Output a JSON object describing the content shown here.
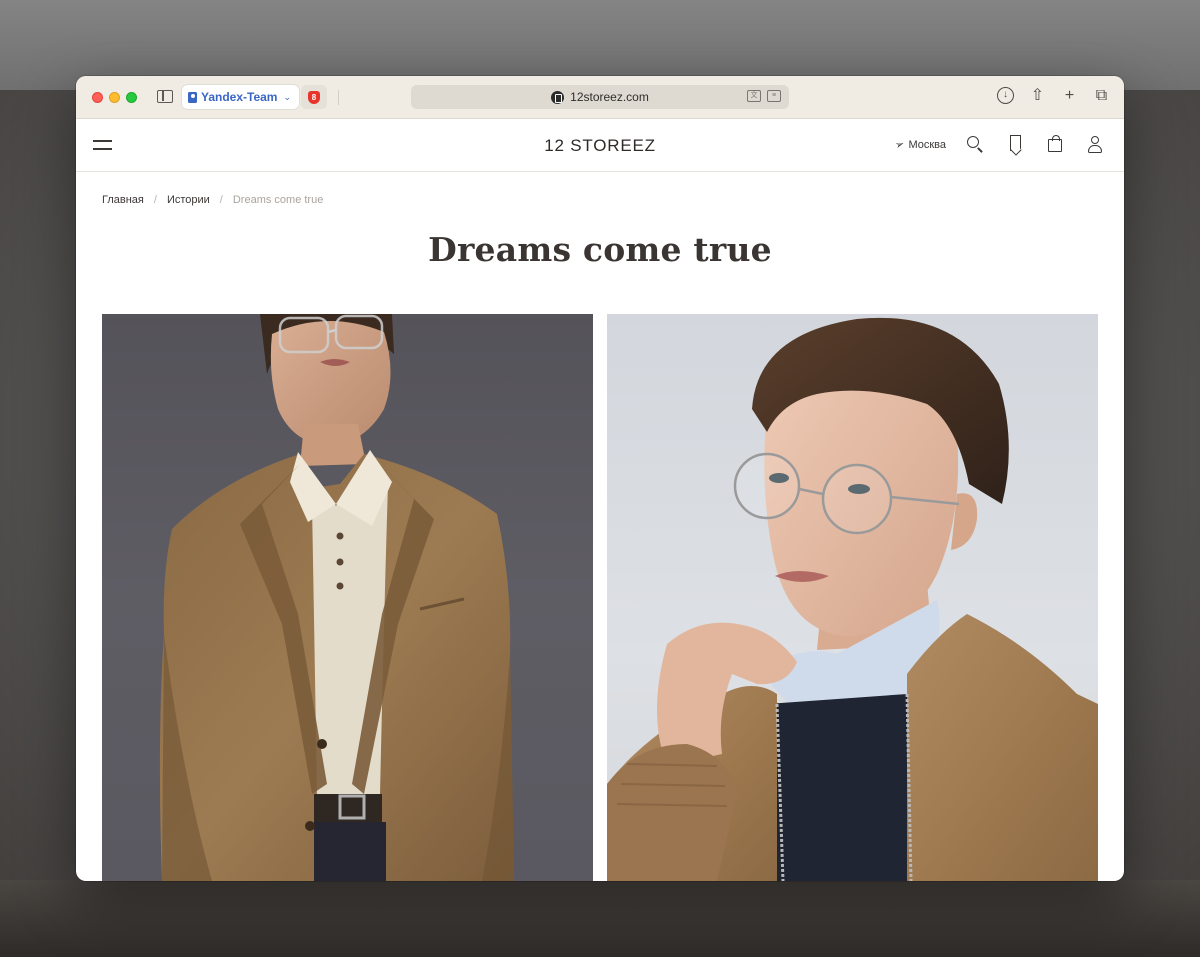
{
  "browser": {
    "profile_label": "Yandex-Team",
    "extension_badge": "8",
    "url": "12storeez.com"
  },
  "header": {
    "logo": "12 STOREEZ",
    "city": "Москва"
  },
  "breadcrumb": {
    "home": "Главная",
    "section": "Истории",
    "current": "Dreams come true",
    "separator": "/"
  },
  "page": {
    "title": "Dreams come true"
  },
  "photos": [
    {
      "alt": "model in camel blazer and polo"
    },
    {
      "alt": "model in glasses and suede bomber"
    }
  ],
  "colors": {
    "accent_blue": "#3a66c4",
    "text_dark": "#3a3532",
    "breadcrumb_muted": "#aaa49d"
  }
}
